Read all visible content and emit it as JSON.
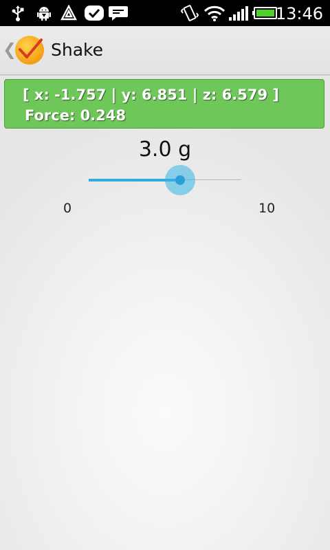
{
  "status_bar": {
    "time": "13:46",
    "icons": [
      "usb-icon",
      "android-debug-icon",
      "notification-triangle-icon",
      "checkmark-app-icon",
      "message-icon",
      "vibrate-icon",
      "wifi-icon",
      "signal-icon",
      "battery-icon"
    ]
  },
  "action_bar": {
    "title": "Shake"
  },
  "sensor": {
    "reading": "[ x: -1.757 | y: 6.851 | z: 6.579 ]",
    "force": "Force: 0.248"
  },
  "threshold": {
    "value_label": "3.0 g",
    "min_label": "0",
    "max_label": "10",
    "fraction": 0.6
  },
  "colors": {
    "panel_green": "#6fc75a",
    "accent_blue": "#33a9dd",
    "logo_orange": "#f7a81b"
  }
}
